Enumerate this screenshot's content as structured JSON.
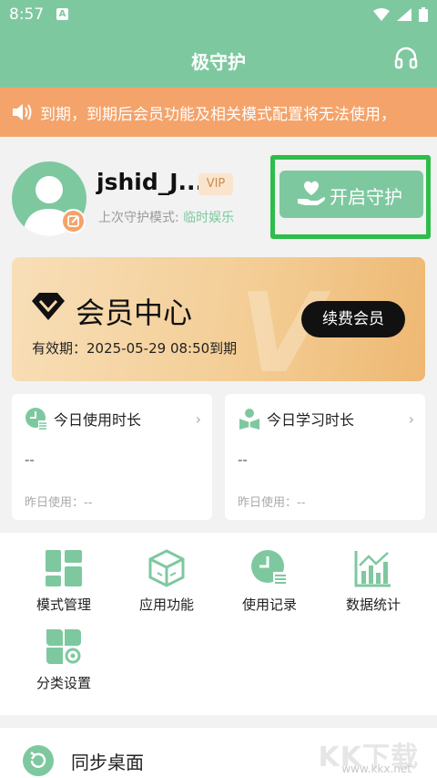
{
  "status_bar": {
    "time": "8:57",
    "notification_icon": "A"
  },
  "app_bar": {
    "title": "极守护",
    "headset_icon": "headset-icon"
  },
  "notice": {
    "icon": "speaker-icon",
    "text": "到期，到期后会员功能及相关模式配置将无法使用，"
  },
  "profile": {
    "username": "jshid_J...",
    "vip_badge": "VIP",
    "last_mode_label": "上次守护模式: ",
    "last_mode_value": "临时娱乐"
  },
  "protect_button": {
    "label": "开启守护"
  },
  "member": {
    "title": "会员中心",
    "watermark": "V",
    "validity": "有效期：2025-05-29 08:50到期",
    "renew_label": "续费会员"
  },
  "cards": [
    {
      "title": "今日使用时长",
      "value": "--",
      "yesterday": "昨日使用：--"
    },
    {
      "title": "今日学习时长",
      "value": "--",
      "yesterday": "昨日使用：--"
    }
  ],
  "grid": [
    {
      "label": "模式管理",
      "icon": "mode-grid-icon"
    },
    {
      "label": "应用功能",
      "icon": "app-box-icon"
    },
    {
      "label": "使用记录",
      "icon": "clock-record-icon"
    },
    {
      "label": "数据统计",
      "icon": "stats-icon"
    },
    {
      "label": "分类设置",
      "icon": "category-settings-icon"
    }
  ],
  "sync": {
    "label": "同步桌面"
  },
  "watermark": {
    "brand": "KK下载",
    "url": "www.kkx.net"
  },
  "colors": {
    "primary": "#7ec8a0",
    "notice": "#f4a36a",
    "highlight": "#2ebd4a"
  }
}
